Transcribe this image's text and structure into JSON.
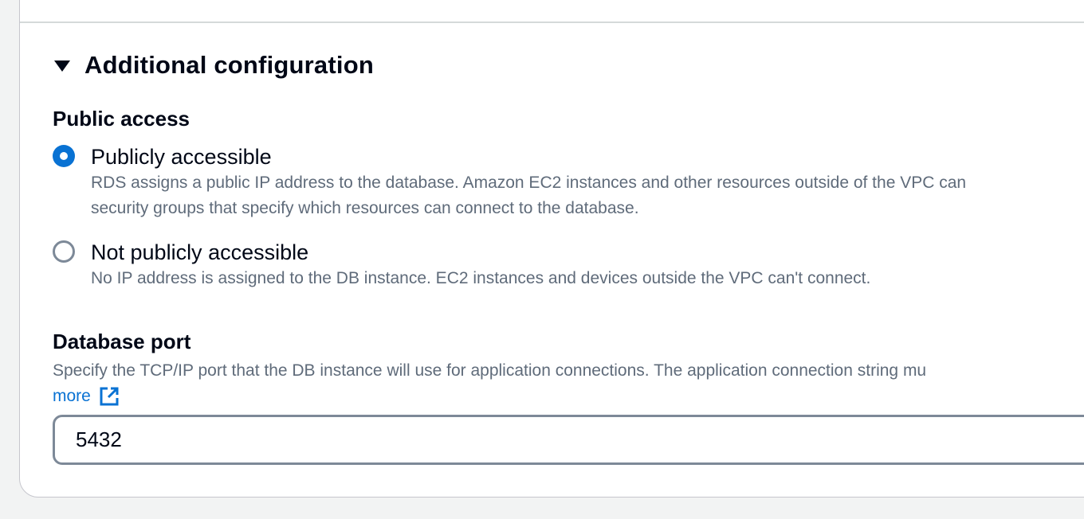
{
  "additional_configuration": {
    "title": "Additional configuration",
    "expanded": true
  },
  "public_access": {
    "label": "Public access",
    "options": [
      {
        "label": "Publicly accessible",
        "description_line1": "RDS assigns a public IP address to the database. Amazon EC2 instances and other resources outside of the VPC can",
        "description_line2": "security groups that specify which resources can connect to the database.",
        "selected": true
      },
      {
        "label": "Not publicly accessible",
        "description_line1": "No IP address is assigned to the DB instance. EC2 instances and devices outside the VPC can't connect.",
        "selected": false
      }
    ]
  },
  "database_port": {
    "label": "Database port",
    "description": "Specify the TCP/IP port that the DB instance will use for application connections. The application connection string mu",
    "learn_more_label": "more",
    "value": "5432"
  },
  "colors": {
    "accent": "#0972d3",
    "text": "#000716",
    "secondary_text": "#5f6b7a",
    "border": "#7d8998"
  },
  "icons": {
    "expander": "caret-down-icon",
    "external_link": "external-link-icon"
  }
}
